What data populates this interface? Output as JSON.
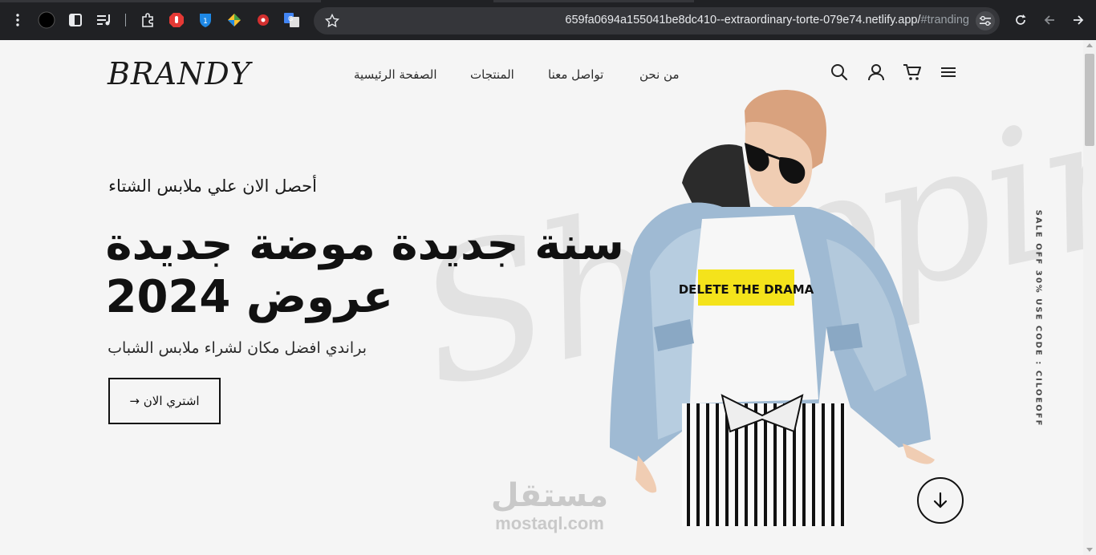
{
  "browser": {
    "url_main": "659fa0694a155041be8dc410--extraordinary-torte-079e74.netlify.app/",
    "url_fragment": "#tranding",
    "icons": [
      "menu-dots-icon",
      "profile-circle-icon",
      "sidebar-icon",
      "media-queue-icon",
      "extensions-icon",
      "adblock-extension-icon",
      "bitwarden-extension-icon",
      "colorful-extension-icon",
      "red-extension-icon",
      "translate-extension-icon",
      "bookmark-star-icon",
      "site-settings-icon",
      "reload-icon",
      "back-icon",
      "forward-icon"
    ]
  },
  "header": {
    "logo": "BRANDY",
    "nav": {
      "home": "الصفحة الرئيسية",
      "products": "المنتجات",
      "contact": "تواصل معنا",
      "about": "من نحن"
    }
  },
  "hero": {
    "subtitle": "أحصل الان علي ملابس الشتاء",
    "headline_line1": "سنة جديدة موضة جديدة",
    "headline_line2": "عروض 2024",
    "description": "براندي افضل مكان لشراء ملابس الشباب",
    "cta_label": "اشتري الان",
    "cta_arrow": "→",
    "side_promo": "SALE OFF 30% USE CODE : CILOEOFF",
    "background_script": "Shopping",
    "tshirt_text": "DELETE THE DRAMA"
  },
  "watermark": {
    "arabic": "مستقل",
    "latin": "mostaql.com"
  },
  "colors": {
    "page_bg": "#f5f5f5",
    "text": "#111111",
    "chrome_bg": "#202124",
    "omnibox_bg": "#35363a"
  }
}
